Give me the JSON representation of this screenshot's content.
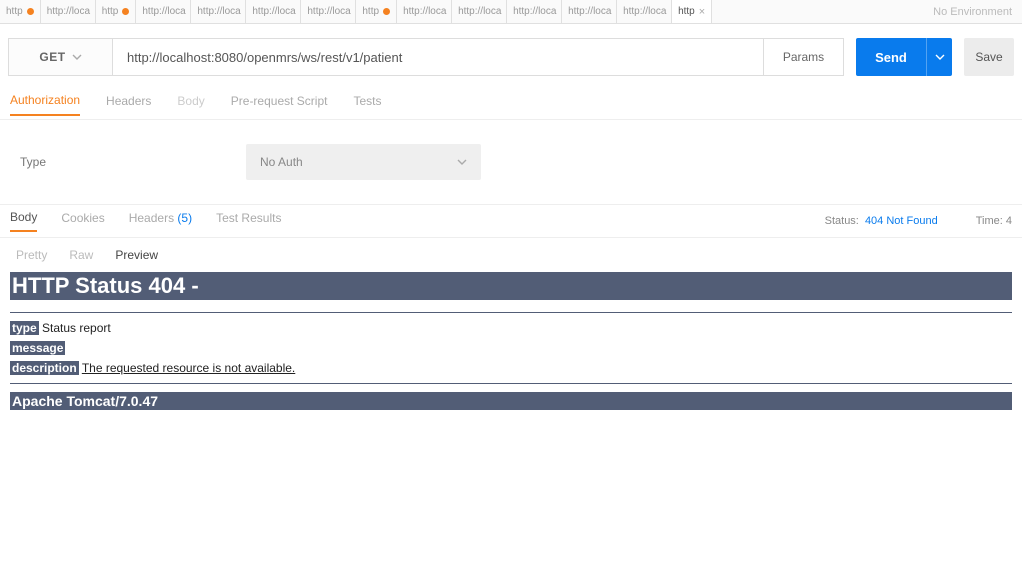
{
  "tabs": [
    {
      "label": "http"
    },
    {
      "label": "http://loca"
    },
    {
      "label": "http"
    },
    {
      "label": "http://loca"
    },
    {
      "label": "http://loca"
    },
    {
      "label": "http://loca"
    },
    {
      "label": "http://loca"
    },
    {
      "label": "http"
    },
    {
      "label": "http://loca"
    },
    {
      "label": "http://loca"
    },
    {
      "label": "http://loca"
    },
    {
      "label": "http://loca"
    },
    {
      "label": "http://loca"
    },
    {
      "label": "http"
    }
  ],
  "environment": "No Environment",
  "request": {
    "method": "GET",
    "url": "http://localhost:8080/openmrs/ws/rest/v1/patient",
    "params_label": "Params",
    "send_label": "Send",
    "save_label": "Save"
  },
  "req_tabs": {
    "authorization": "Authorization",
    "headers": "Headers",
    "body": "Body",
    "prerequest": "Pre-request Script",
    "tests": "Tests"
  },
  "auth": {
    "type_label": "Type",
    "selected": "No Auth"
  },
  "resp_tabs": {
    "body": "Body",
    "cookies": "Cookies",
    "headers": "Headers",
    "headers_count": "(5)",
    "tests": "Test Results"
  },
  "status": {
    "label": "Status:",
    "value": "404 Not Found",
    "time_label": "Time:",
    "time_value": "4"
  },
  "view_tabs": {
    "pretty": "Pretty",
    "raw": "Raw",
    "preview": "Preview"
  },
  "response_body": {
    "heading": "HTTP Status 404 -",
    "type_label": "type",
    "type_value": " Status report",
    "message_label": "message",
    "description_label": "description",
    "description_value": "The requested resource is not available.",
    "server": "Apache Tomcat/7.0.47"
  }
}
